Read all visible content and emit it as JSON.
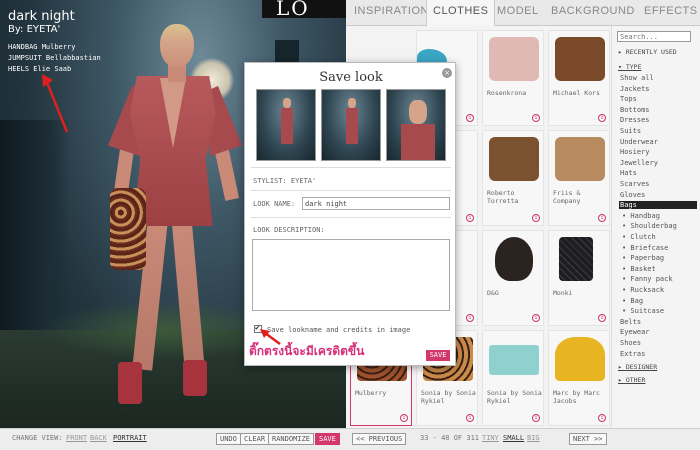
{
  "scene": {
    "title": "dark night",
    "by": "By: EYETA'",
    "credits": [
      "HANDBAG Mulberry",
      "JUMPSUIT Bellabbastian",
      "HEELS Elie Saab"
    ],
    "brand_text": "LO"
  },
  "tabs": [
    {
      "label": "INSPIRATION",
      "active": false
    },
    {
      "label": "CLOTHES",
      "active": true
    },
    {
      "label": "MODEL",
      "active": false
    },
    {
      "label": "BACKGROUND",
      "active": false
    },
    {
      "label": "EFFECTS",
      "active": false
    }
  ],
  "sidebar": {
    "search_placeholder": "Search...",
    "recently_used": "RECENTLY USED",
    "type_header": "TYPE",
    "type_items": [
      "Show all",
      "Jackets",
      "Tops",
      "Bottoms",
      "Dresses",
      "Suits",
      "Underwear",
      "Hosiery",
      "Jewellery",
      "Hats",
      "Scarves",
      "Gloves",
      "Bags"
    ],
    "bag_subitems": [
      "• Handbag",
      "• Shoulderbag",
      "• Clutch",
      "• Briefcase",
      "• Paperbag",
      "• Basket",
      "• Fanny pack",
      "• Rucksack",
      "• Bag",
      "• Suitcase"
    ],
    "after_items": [
      "Belts",
      "Eyewear",
      "Shoes",
      "Extras"
    ],
    "designer_header": "DESIGNER",
    "other_header": "OTHER",
    "selected": "Bags"
  },
  "grid": {
    "cells": [
      {
        "label": "",
        "color": "#3aa6c4"
      },
      {
        "label": "Rosenkrona",
        "color": "#e0b8b4"
      },
      {
        "label": "Michael Kors",
        "color": "#7a4a2a"
      },
      {
        "label": "",
        "color": "#1e1e1e"
      },
      {
        "label": "Roberto Torretta",
        "color": "#7a5230"
      },
      {
        "label": "Friis & Company",
        "color": "#b78a60"
      },
      {
        "label": "",
        "color": "#c0262a"
      },
      {
        "label": "D&G",
        "color": "#2a2320"
      },
      {
        "label": "Monki",
        "color": "#1e1e22"
      },
      {
        "label": "Mulberry",
        "color": "#a0522d"
      },
      {
        "label": "Sonia by Sonia Rykiel",
        "color": "#c98a4a"
      },
      {
        "label": "Sonia by Sonia Rykiel",
        "color": "#8fd1cf"
      },
      {
        "label": "Marc by Marc Jacobs",
        "color": "#e8b422"
      }
    ],
    "info_glyph": "i"
  },
  "bottombar": {
    "change_view_label": "CHANGE VIEW:",
    "front": "FRONT",
    "back": "BACK",
    "portrait": "PORTRAIT",
    "undo": "UNDO",
    "clear": "CLEAR",
    "randomize": "RANDOMIZE",
    "save": "SAVE",
    "previous": "<< PREVIOUS",
    "page_info": "33 - 48 OF 311",
    "tiny": "TINY",
    "small": "SMALL",
    "big": "BIG",
    "next": "NEXT >>"
  },
  "modal": {
    "title": "Save look",
    "close_glyph": "×",
    "stylist": "STYLIST: EYETA'",
    "look_name_label": "LOOK NAME:",
    "look_name_value": "dark night",
    "look_description_label": "LOOK DESCRIPTION:",
    "look_description_value": "",
    "checkbox_label": "Save lookname and credits in image",
    "checkbox_checked": true,
    "annotation_thai": "ติ๊กตรงนี้จะมีเครดิตขึ้น",
    "save_label": "SAVE"
  },
  "colors": {
    "accent": "#d2386a",
    "annotation": "#d6307a",
    "arrow": "#e02020"
  }
}
